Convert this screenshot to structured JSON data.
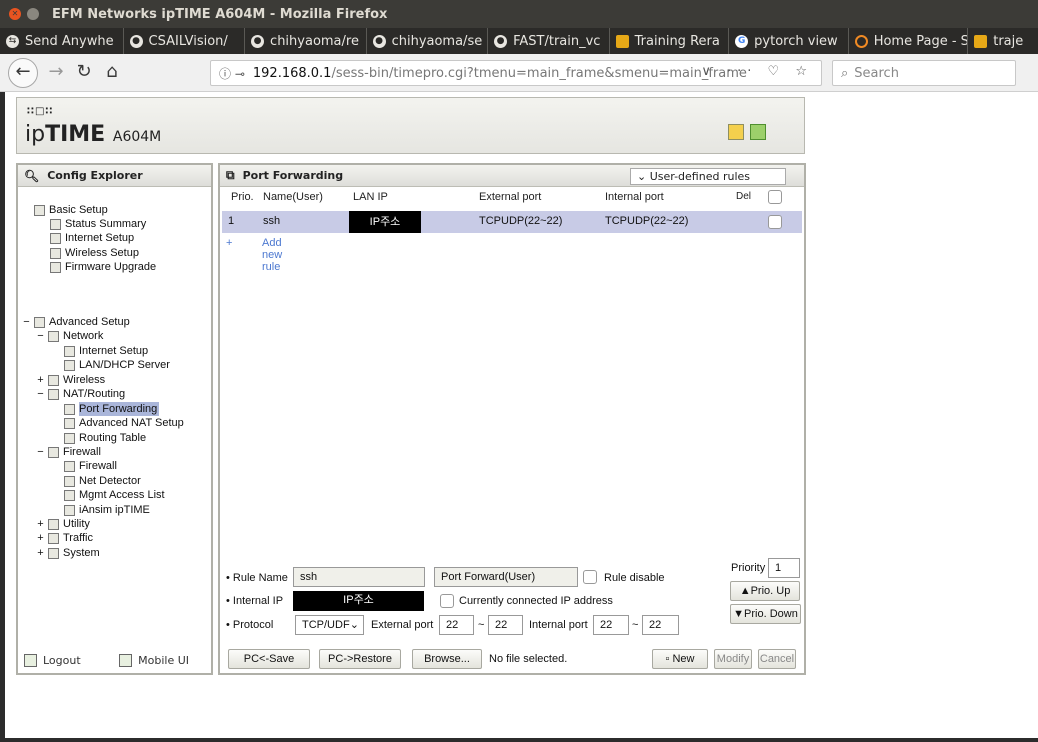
{
  "window": {
    "title": "EFM Networks ipTIME A604M - Mozilla Firefox"
  },
  "tabs": [
    {
      "label": "Send Anywhe",
      "icon": "send-anywhere-icon"
    },
    {
      "label": "CSAILVision/",
      "icon": "github-icon"
    },
    {
      "label": "chihyaoma/re",
      "icon": "github-icon"
    },
    {
      "label": "chihyaoma/se",
      "icon": "github-icon"
    },
    {
      "label": "FAST/train_vc",
      "icon": "github-icon"
    },
    {
      "label": "Training Rera",
      "icon": "book-icon"
    },
    {
      "label": "pytorch view",
      "icon": "google-icon"
    },
    {
      "label": "Home Page - S",
      "icon": "ring-icon"
    },
    {
      "label": "traje",
      "icon": "book-icon"
    }
  ],
  "nav": {
    "url_host": "192.168.0.1",
    "url_path": "/sess-bin/timepro.cgi?tmenu=main_frame&smenu=main_frame",
    "search_placeholder": "Search"
  },
  "header": {
    "brand_top": "∷□∷",
    "brand_ip": "ip",
    "brand_time": "TIME",
    "brand_model": "A604M"
  },
  "explorer": {
    "title": "Config Explorer",
    "logout": "Logout",
    "mobile": "Mobile UI",
    "items": [
      {
        "label": "Basic Setup",
        "exp": ""
      },
      {
        "label": "Status Summary"
      },
      {
        "label": "Internet Setup"
      },
      {
        "label": "Wireless Setup"
      },
      {
        "label": "Firmware Upgrade"
      },
      {
        "label": "Advanced Setup",
        "exp": "−"
      },
      {
        "label": "Network",
        "exp": "−"
      },
      {
        "label": "Internet Setup"
      },
      {
        "label": "LAN/DHCP Server"
      },
      {
        "label": "Wireless",
        "exp": "+"
      },
      {
        "label": "NAT/Routing",
        "exp": "−"
      },
      {
        "label": "Port Forwarding"
      },
      {
        "label": "Advanced NAT Setup"
      },
      {
        "label": "Routing Table"
      },
      {
        "label": "Firewall",
        "exp": "−"
      },
      {
        "label": "Firewall"
      },
      {
        "label": "Net Detector"
      },
      {
        "label": "Mgmt Access List"
      },
      {
        "label": "iAnsim ipTIME"
      },
      {
        "label": "Utility",
        "exp": "+"
      },
      {
        "label": "Traffic",
        "exp": "+"
      },
      {
        "label": "System",
        "exp": "+"
      }
    ]
  },
  "port_forwarding": {
    "title": "Port Forwarding",
    "filter": "User-defined rules",
    "columns": {
      "prio": "Prio.",
      "name": "Name(User)",
      "lan_ip": "LAN IP",
      "ext": "External port",
      "int": "Internal port",
      "del": "Del"
    },
    "rows": [
      {
        "prio": "1",
        "name": "ssh",
        "lan_ip": "IP주소",
        "ext": "TCPUDP(22~22)",
        "int": "TCPUDP(22~22)"
      }
    ],
    "add_plus": "+",
    "add_label": "Add new rule"
  },
  "form": {
    "rule_name_label": "• Rule Name",
    "rule_name": "ssh",
    "type": "Port Forward(User)",
    "rule_disable": "Rule disable",
    "internal_ip_label": "• Internal IP",
    "internal_ip": "IP주소",
    "connected_ip": "Currently connected IP address",
    "protocol_label": "• Protocol",
    "protocol": "TCP/UDF",
    "external_port_label": "External port",
    "ext_from": "22",
    "ext_to": "22",
    "internal_port_label": "Internal port",
    "int_from": "22",
    "int_to": "22",
    "tilde": "~",
    "priority_label": "Priority",
    "priority": "1",
    "prio_up": "▲Prio. Up",
    "prio_down": "▼Prio. Down",
    "pc_save": "PC<-Save",
    "pc_restore": "PC->Restore",
    "browse": "Browse...",
    "no_file": "No file selected.",
    "new": "New",
    "modify": "Modify",
    "cancel": "Cancel"
  }
}
